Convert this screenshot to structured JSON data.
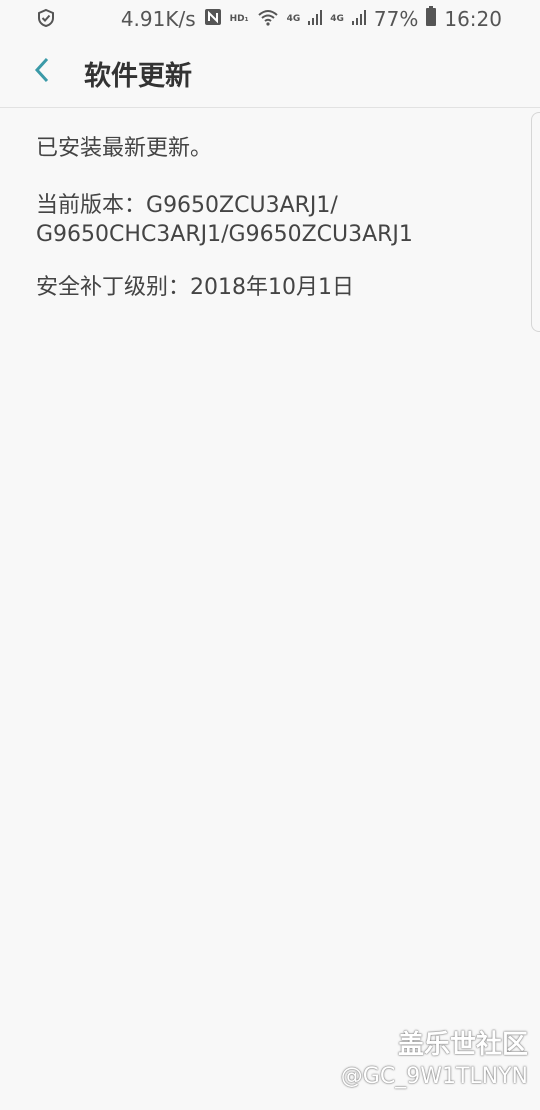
{
  "status_bar": {
    "network_speed": "4.91K/s",
    "hd_label": "HD₁",
    "signal_label_1": "4G",
    "signal_label_2": "4G",
    "battery": "77%",
    "time": "16:20"
  },
  "app_bar": {
    "title": "软件更新"
  },
  "content": {
    "message": "已安装最新更新。",
    "version_label": "当前版本：",
    "version_line1": "G9650ZCU3ARJ1/",
    "version_line2": "G9650CHC3ARJ1/G9650ZCU3ARJ1",
    "patch_label": "安全补丁级别：",
    "patch_value": "2018年10月1日"
  },
  "watermark": {
    "title": "盖乐世社区",
    "user": "@GC_9W1TLNYN"
  },
  "colors": {
    "accent": "#3b9aa8",
    "background": "#f8f8f8",
    "text": "#444444"
  },
  "icons": {
    "status_left": "shield-check-icon",
    "nfc": "nfc-icon",
    "wifi": "wifi-icon",
    "signal": "signal-icon",
    "battery": "battery-icon",
    "back": "chevron-left-icon"
  }
}
